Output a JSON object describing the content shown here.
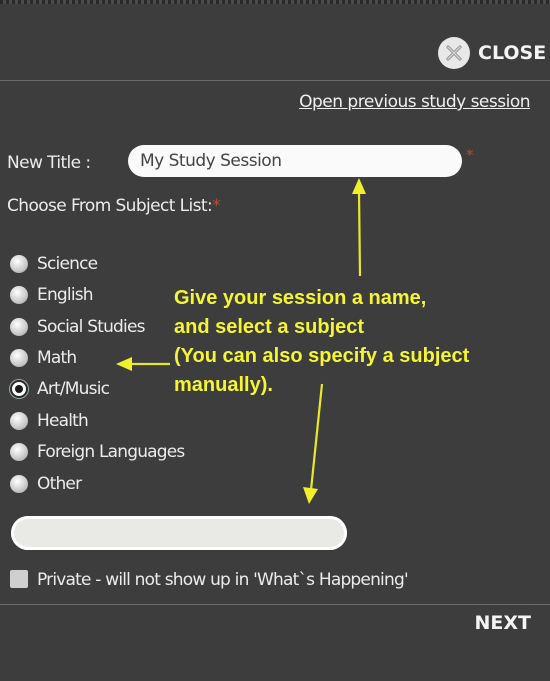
{
  "header": {
    "close_label": "CLOSE",
    "close_icon": "close-icon"
  },
  "links": {
    "open_previous": "Open previous study session"
  },
  "form": {
    "new_title_label": "New Title :",
    "new_title_value": "My Study Session",
    "choose_subject_label": "Choose From Subject List:",
    "required_marker": "*",
    "subjects": [
      {
        "label": "Science",
        "checked": false
      },
      {
        "label": "English",
        "checked": false
      },
      {
        "label": "Social Studies",
        "checked": false
      },
      {
        "label": "Math",
        "checked": false
      },
      {
        "label": "Art/Music",
        "checked": true
      },
      {
        "label": "Health",
        "checked": false
      },
      {
        "label": "Foreign Languages",
        "checked": false
      },
      {
        "label": "Other",
        "checked": false
      }
    ],
    "custom_subject_value": "",
    "private_label": "Private - will not show up in 'What`s Happening'",
    "private_checked": false
  },
  "footer": {
    "next_label": "NEXT"
  },
  "annotation": {
    "lines": [
      "Give your session a name,",
      "and select a subject",
      "(You can also specify a subject",
      "manually)."
    ],
    "color": "#f5f534"
  },
  "colors": {
    "background": "#3d3d3d",
    "required": "#c0482a",
    "text": "#ececec"
  }
}
